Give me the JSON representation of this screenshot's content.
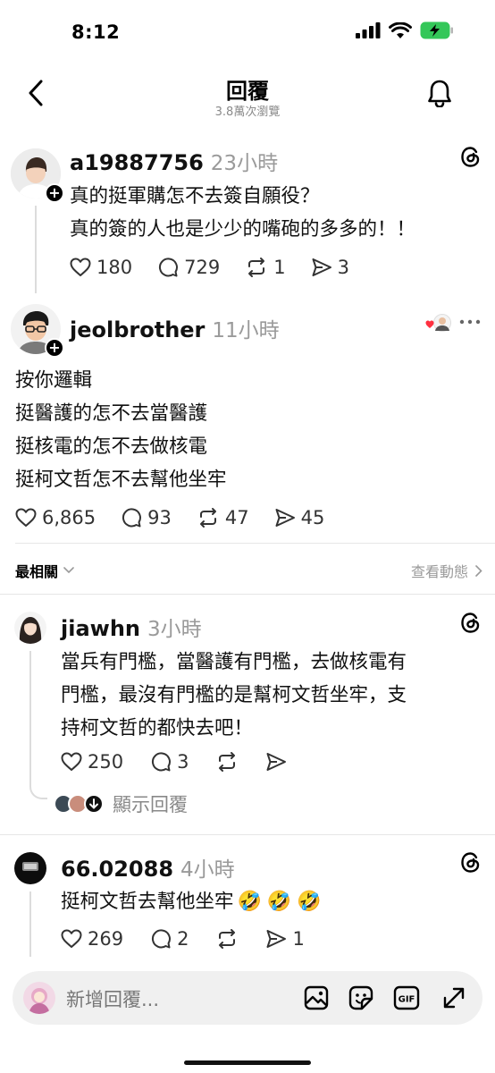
{
  "status_bar": {
    "time": "8:12"
  },
  "header": {
    "title": "回覆",
    "views": "3.8萬次瀏覽"
  },
  "root_post": {
    "username": "a19887756",
    "time": "23小時",
    "lines": [
      "真的挺軍購怎不去簽自願役？",
      "真的簽的人也是少少的嘴砲的多多的！！"
    ],
    "likes": "180",
    "comments": "729",
    "reposts": "1",
    "shares": "3"
  },
  "reply_post": {
    "username": "jeolbrother",
    "time": "11小時",
    "lines": [
      "按你邏輯",
      "挺醫護的怎不去當醫護",
      "挺核電的怎不去做核電",
      "挺柯文哲怎不去幫他坐牢"
    ],
    "likes": "6,865",
    "comments": "93",
    "reposts": "47",
    "shares": "45"
  },
  "sort": {
    "label": "最相關",
    "activity_link": "查看動態"
  },
  "comments": [
    {
      "username": "jiawhn",
      "time": "3小時",
      "lines": [
        "當兵有門檻，當醫護有門檻，去做核電有",
        "門檻，最沒有門檻的是幫柯文哲坐牢，支",
        "持柯文哲的都快去吧！"
      ],
      "likes": "250",
      "comments": "3",
      "show_replies": "顯示回覆"
    },
    {
      "username": "66.02088",
      "time": "4小時",
      "text": "挺柯文哲去幫他坐牢",
      "emojis": "🤣🤣🤣",
      "likes": "269",
      "comments": "2",
      "shares": "1"
    }
  ],
  "composer": {
    "placeholder": "新增回覆..."
  },
  "icons": {
    "back": "chevron-left-icon",
    "bell": "bell-icon",
    "threads": "threads-icon",
    "heart": "heart-icon",
    "comment": "comment-icon",
    "repost": "repost-icon",
    "share": "share-icon",
    "image": "image-icon",
    "sticker": "sticker-icon",
    "gif": "gif-icon",
    "expand": "expand-icon"
  }
}
